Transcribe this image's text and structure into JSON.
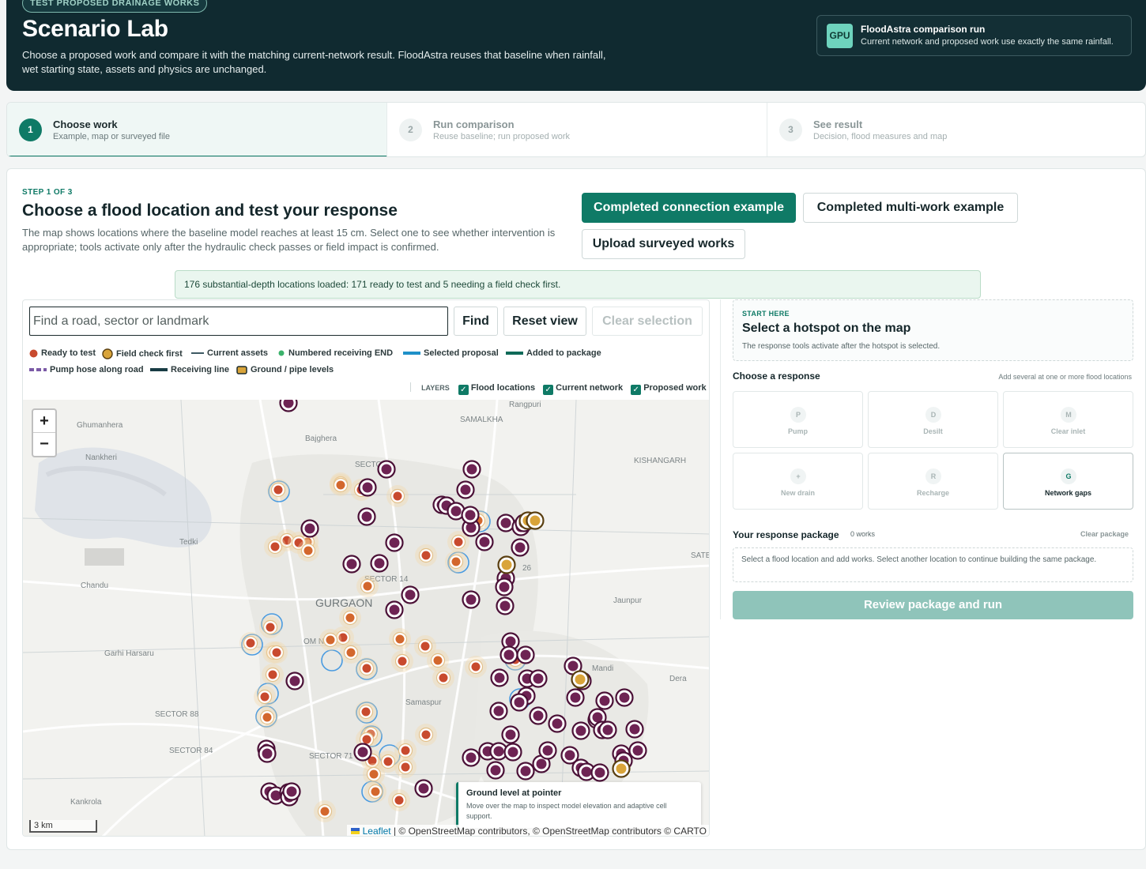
{
  "header": {
    "tag": "TEST PROPOSED DRAINAGE WORKS",
    "title": "Scenario Lab",
    "description": "Choose a proposed work and compare it with the matching current-network result. FloodAstra reuses that baseline when rainfall, wet starting state, assets and physics are unchanged.",
    "gpu_badge": "GPU",
    "gpu_title": "FloodAstra comparison run",
    "gpu_sub": "Current network and proposed work use exactly the same rainfall."
  },
  "steps": [
    {
      "num": "1",
      "title": "Choose work",
      "sub": "Example, map or surveyed file"
    },
    {
      "num": "2",
      "title": "Run comparison",
      "sub": "Reuse baseline; run proposed work"
    },
    {
      "num": "3",
      "title": "See result",
      "sub": "Decision, flood measures and map"
    }
  ],
  "main": {
    "eyebrow": "STEP 1 OF 3",
    "title": "Choose a flood location and test your response",
    "lead": "The map shows locations where the baseline model reaches at least 15 cm. Select one to see whether intervention is appropriate; tools activate only after the hydraulic check passes or field impact is confirmed.",
    "btn_connection": "Completed connection example",
    "btn_multi": "Completed multi-work example",
    "btn_upload": "Upload surveyed works",
    "notice": "176 substantial-depth locations loaded: 171 ready to test and 5 needing a field check first."
  },
  "map": {
    "search_placeholder": "Find a road, sector or landmark",
    "find": "Find",
    "reset": "Reset view",
    "clear": "Clear selection",
    "legend": {
      "ready": "Ready to test",
      "field": "Field check first",
      "assets": "Current assets",
      "end": "Numbered receiving END",
      "selected": "Selected proposal",
      "added": "Added to package",
      "hose": "Pump hose along road",
      "receiving": "Receiving line",
      "levels": "Ground / pipe levels"
    },
    "layers_label": "LAYERS",
    "layer_flood": "Flood locations",
    "layer_network": "Current network",
    "layer_proposed": "Proposed work",
    "zoom_in": "+",
    "zoom_out": "−",
    "scale": "3 km",
    "attrib_leaflet": "Leaflet",
    "attrib_rest": " | © OpenStreetMap contributors, © OpenStreetMap contributors © CARTO",
    "places": [
      "Rangpuri",
      "Ghumanhera",
      "Bajghera",
      "SAMALKHA",
      "Nankheri",
      "KISHANGARH",
      "Tedki",
      "SATB",
      "Chandu",
      "GURGAON",
      "SECTOR 14",
      "Jaunpur",
      "Garhi Harsaru",
      "OM N",
      "Mandi",
      "Dera",
      "Samaspur",
      "SECTOR 88",
      "SECTOR 84",
      "SECTOR 71",
      "Kankrola",
      "SECTO",
      "26"
    ],
    "ground_title": "Ground level at pointer",
    "ground_sub": "Move over the map to inspect model elevation and adaptive cell support."
  },
  "panel": {
    "start_eyebrow": "START HERE",
    "start_title": "Select a hotspot on the map",
    "start_sub": "The response tools activate after the hotspot is selected.",
    "response_title": "Choose a response",
    "response_note": "Add several at one or more flood locations",
    "tiles": [
      {
        "icon": "P",
        "label": "Pump"
      },
      {
        "icon": "D",
        "label": "Desilt"
      },
      {
        "icon": "M",
        "label": "Clear inlet"
      },
      {
        "icon": "+",
        "label": "New drain"
      },
      {
        "icon": "R",
        "label": "Recharge"
      },
      {
        "icon": "G",
        "label": "Network gaps"
      }
    ],
    "package_title": "Your response package",
    "package_count": "0 works",
    "package_clear": "Clear package",
    "package_note": "Select a flood location and add works. Select another location to continue building the same package.",
    "review": "Review package and run"
  },
  "colors": {
    "ready": "#c84a2e",
    "field": "#d9a43a",
    "hotspot": "#6e2353",
    "selected": "#3a8fd8",
    "accent": "#0f7a66"
  }
}
